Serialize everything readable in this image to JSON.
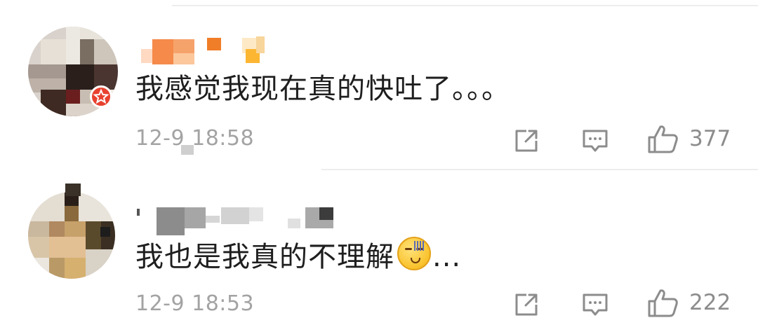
{
  "comments": [
    {
      "text": "我感觉我现在真的快吐了。。。",
      "time": "12-9 18:58",
      "likes": "377"
    },
    {
      "text": "我也是我真的不理解",
      "text_suffix": "...",
      "emoji": "awkward-face-emoji",
      "time": "12-9 18:53",
      "likes": "222"
    }
  ],
  "icons": {
    "share": "share-icon",
    "reply": "comment-icon",
    "like": "thumbs-up-icon"
  },
  "colors": {
    "text": "#1e1e1e",
    "meta": "#a3a3a3",
    "icon": "#8c8c8c",
    "divider": "#ededed"
  }
}
